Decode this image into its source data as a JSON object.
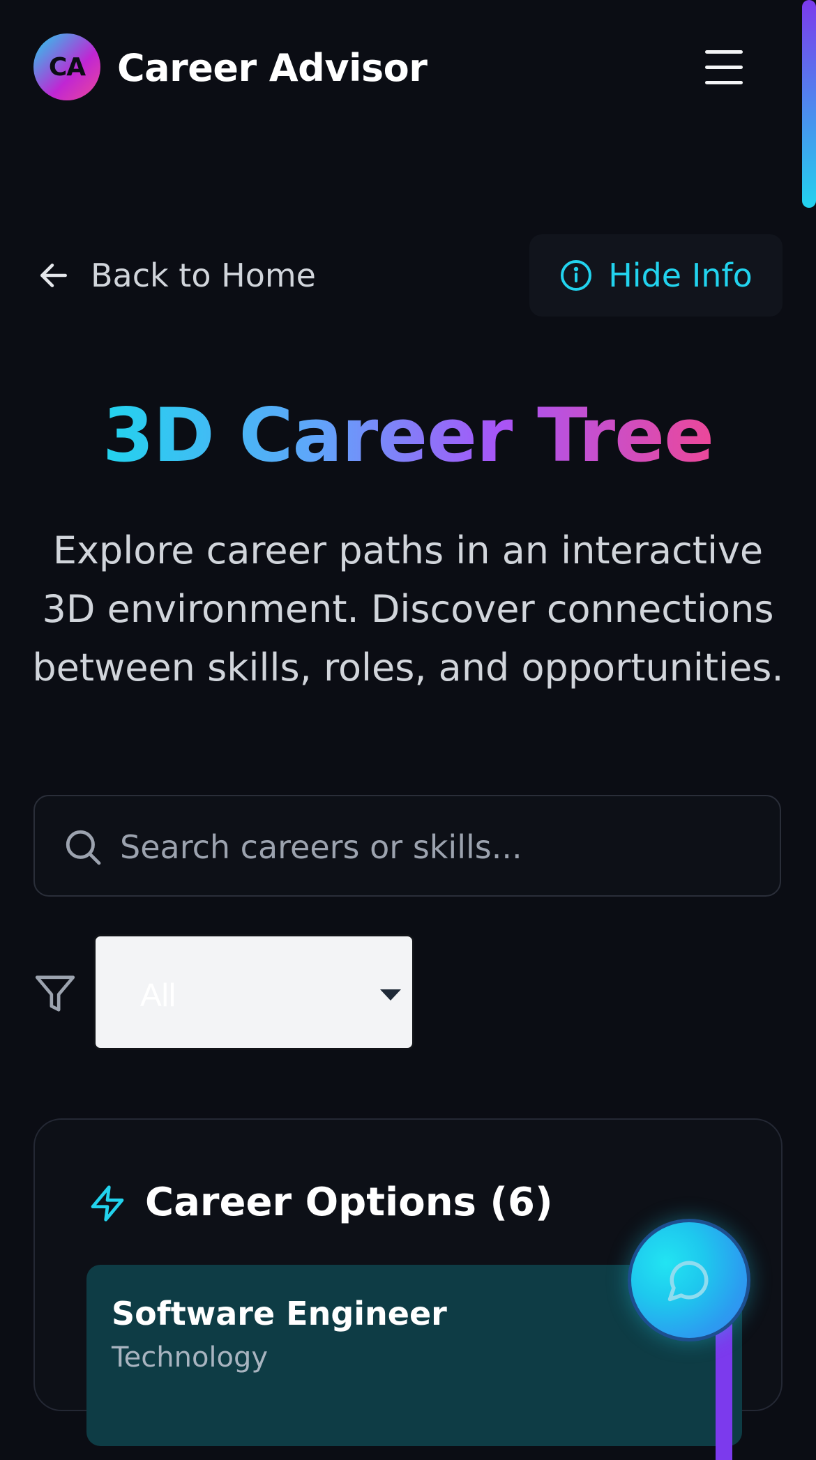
{
  "header": {
    "logo_initials": "CA",
    "app_title": "Career Advisor"
  },
  "nav": {
    "back_label": "Back to Home",
    "hide_info_label": "Hide Info"
  },
  "hero": {
    "title": "3D Career Tree",
    "subtitle": "Explore career paths in an interactive 3D environment. Discover connections between skills, roles, and opportunities."
  },
  "search": {
    "placeholder": "Search careers or skills...",
    "value": ""
  },
  "filter": {
    "selected": "All"
  },
  "career_options": {
    "title": "Career Options (6)",
    "items": [
      {
        "title": "Software Engineer",
        "category": "Technology"
      }
    ]
  },
  "colors": {
    "background": "#0b0d14",
    "accent_cyan": "#22d3ee",
    "accent_pink": "#ec4899",
    "accent_purple": "#7c3aed",
    "card_item_bg": "#0e3c45"
  },
  "icons": {
    "menu": "hamburger-icon",
    "back": "arrow-left-icon",
    "info": "info-icon",
    "search": "search-icon",
    "filter": "filter-icon",
    "options": "lightning-icon",
    "chat": "chat-bubble-icon"
  }
}
